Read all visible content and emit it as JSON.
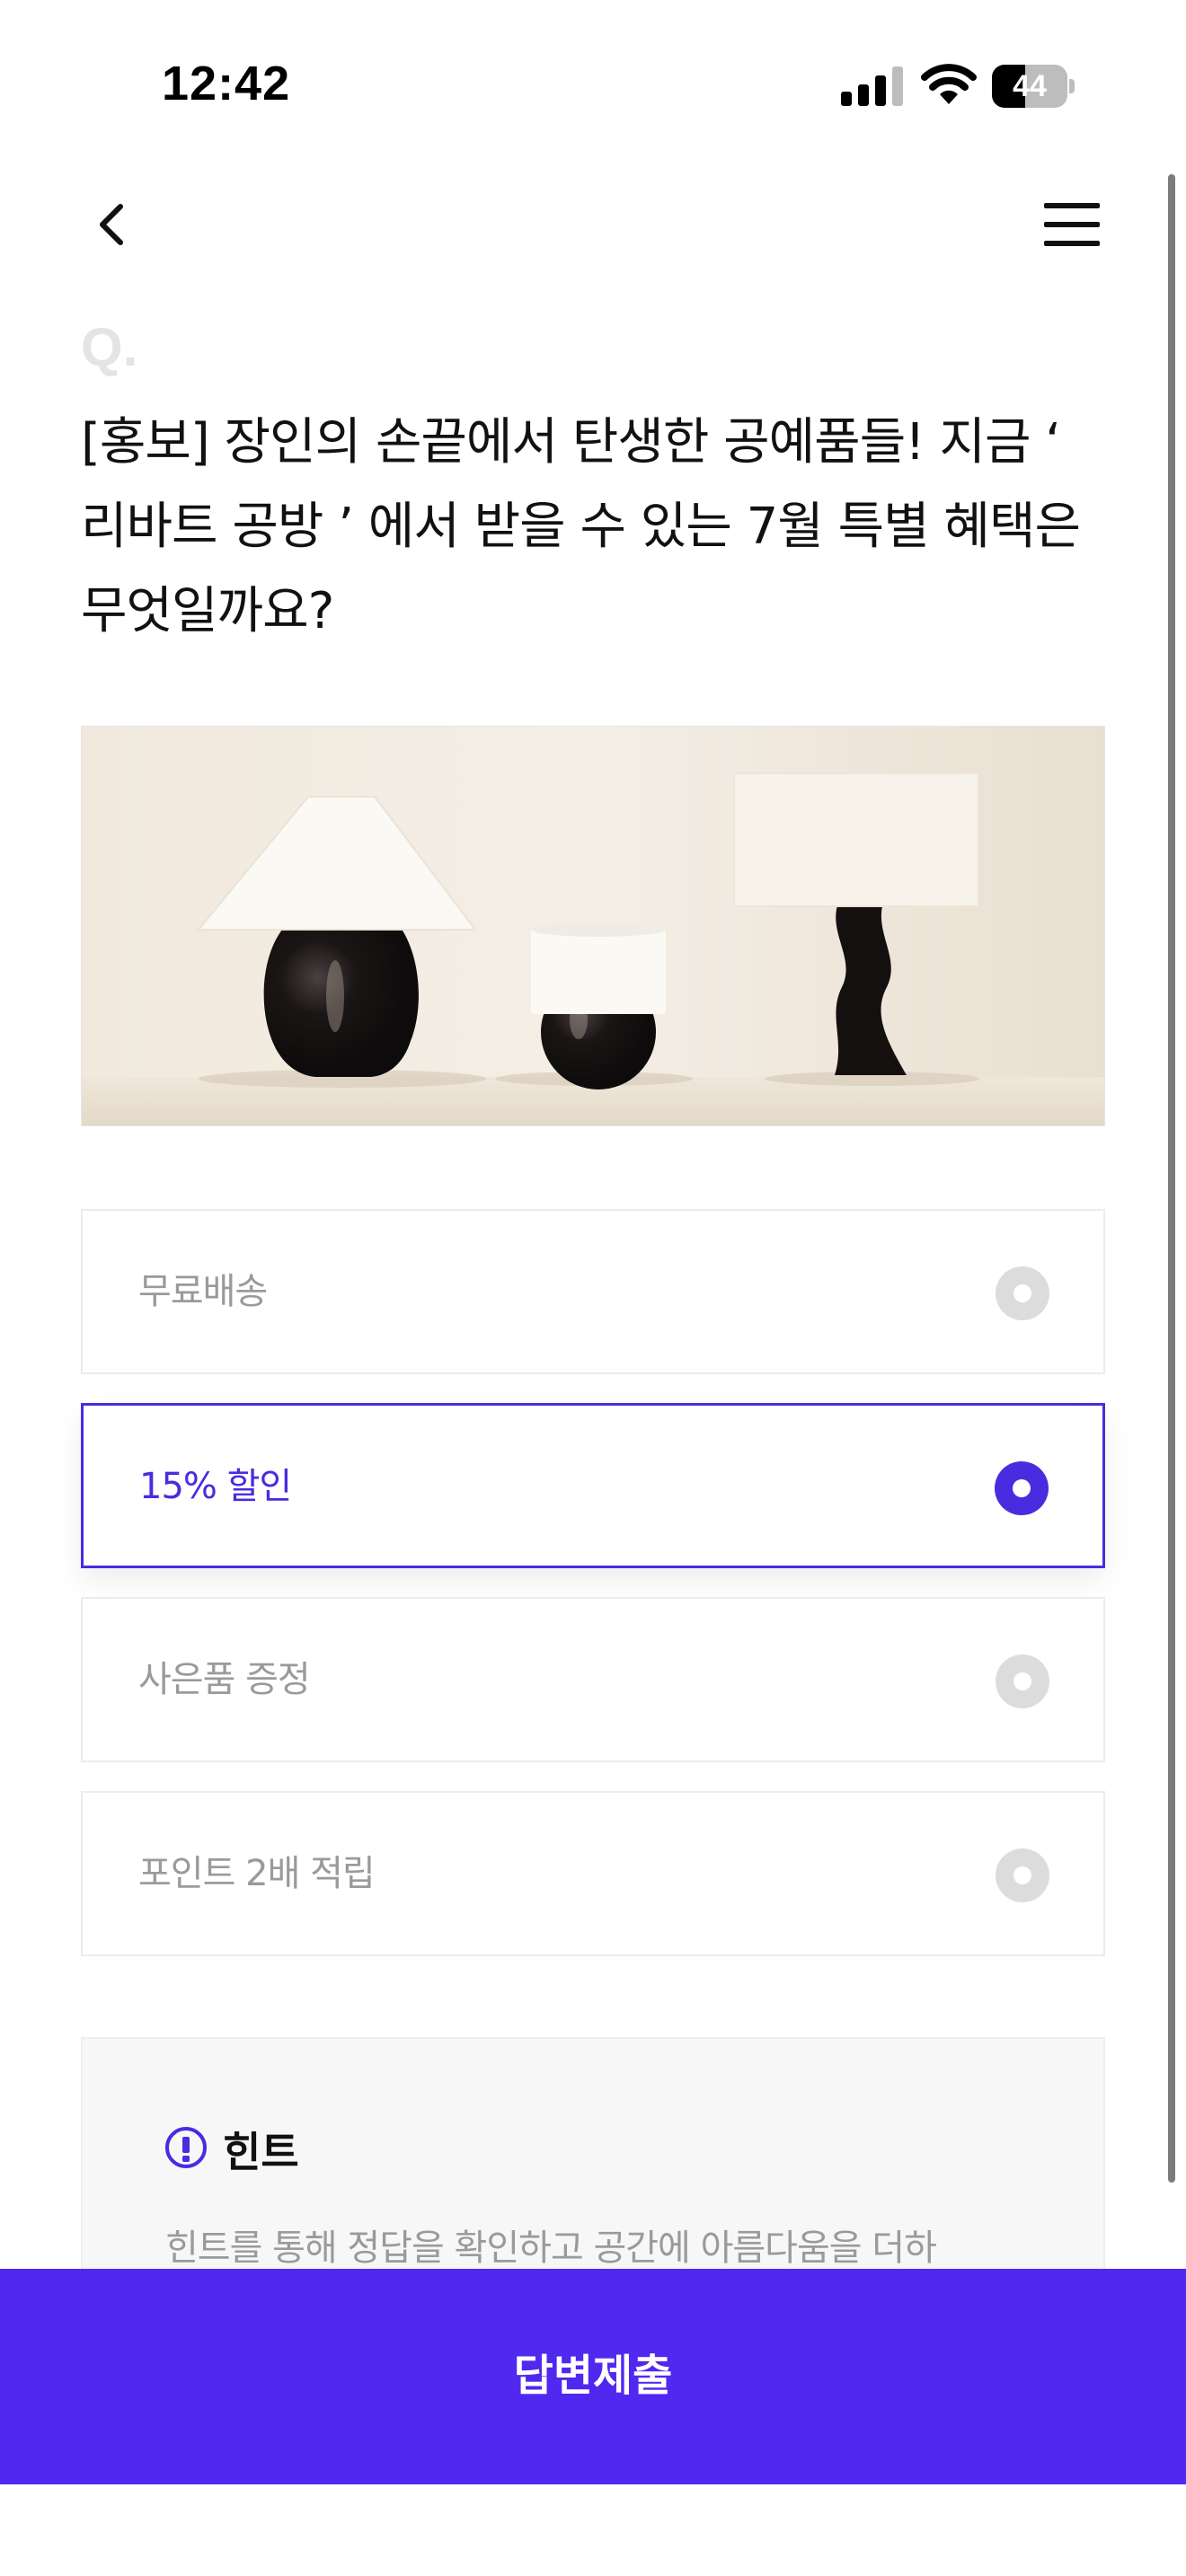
{
  "status_bar": {
    "time": "12:42",
    "battery": "44",
    "battery_level": 0.44
  },
  "nav": {
    "back_icon": "chevron-left-icon",
    "menu_icon": "hamburger-menu-icon"
  },
  "question": {
    "mark": "Q.",
    "text": "[홍보] 장인의 손끝에서 탄생한 공예품들! 지금 ‘ 리바트 공방 ’ 에서 받을 수 있는 7월 특별 혜택은 무엇일까요?"
  },
  "options": [
    {
      "label": "무료배송",
      "selected": false
    },
    {
      "label": "15% 할인",
      "selected": true
    },
    {
      "label": "사은품 증정",
      "selected": false
    },
    {
      "label": "포인트 2배 적립",
      "selected": false
    }
  ],
  "hint": {
    "title": "힌트",
    "text": "힌트를 통해 정답을 확인하고 공간에 아름다움을 더하"
  },
  "submit": {
    "label": "답변제출"
  },
  "colors": {
    "accent": "#4b2be0",
    "submit_bg": "#5028f0",
    "option_border": "#ececec",
    "muted_text": "#9a9a9a"
  }
}
